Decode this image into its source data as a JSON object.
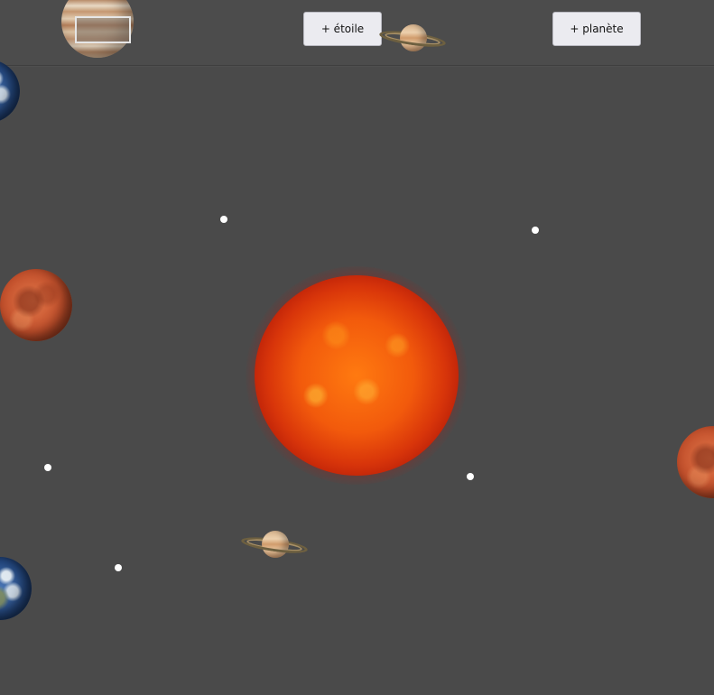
{
  "toolbar": {
    "add_star_label": "+ étoile",
    "add_planet_label": "+ planète",
    "name_input_value": ""
  },
  "colors": {
    "background": "#4a4a4a",
    "button_background": "#ebebf0",
    "star_dot": "#ffffff",
    "sun_core": "#ff7a10"
  },
  "canvas": {
    "sun": "sun-icon",
    "planets": [
      "jupiter-icon",
      "saturn-icon",
      "earth-icon",
      "mars-icon",
      "saturn-icon",
      "earth-icon",
      "mars-icon"
    ],
    "star_count": 5
  }
}
